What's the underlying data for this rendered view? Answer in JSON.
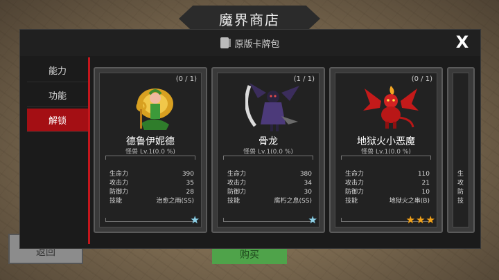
{
  "screen": {
    "title": "魔界商店",
    "back_label": "返回",
    "buy_label": "购买"
  },
  "modal": {
    "header": "原版卡牌包",
    "close_label": "X"
  },
  "sidebar": {
    "items": [
      {
        "label": "能力",
        "active": false
      },
      {
        "label": "功能",
        "active": false
      },
      {
        "label": "解锁",
        "active": true
      }
    ]
  },
  "cards": [
    {
      "count": "(0 / 1)",
      "name": "德鲁伊妮德",
      "level": "怪兽 Lv.1(0.0 %)",
      "stats": [
        {
          "label": "生命力",
          "value": "390"
        },
        {
          "label": "攻击力",
          "value": "35"
        },
        {
          "label": "防御力",
          "value": "28"
        },
        {
          "label": "技能",
          "value": "治愈之雨(SS)"
        }
      ],
      "stars": {
        "count": 1,
        "color": "blue"
      },
      "art_icon": "druid-sprite"
    },
    {
      "count": "(1 / 1)",
      "name": "骨龙",
      "level": "怪兽 Lv.1(0.0 %)",
      "stats": [
        {
          "label": "生命力",
          "value": "380"
        },
        {
          "label": "攻击力",
          "value": "34"
        },
        {
          "label": "防御力",
          "value": "30"
        },
        {
          "label": "技能",
          "value": "腐朽之息(SS)"
        }
      ],
      "stars": {
        "count": 1,
        "color": "blue"
      },
      "art_icon": "bone-dragon-sprite"
    },
    {
      "count": "(0 / 1)",
      "name": "地狱火小恶魔",
      "level": "怪兽 Lv.1(0.0 %)",
      "stats": [
        {
          "label": "生命力",
          "value": "110"
        },
        {
          "label": "攻击力",
          "value": "21"
        },
        {
          "label": "防御力",
          "value": "10"
        },
        {
          "label": "技能",
          "value": "地狱火之串(B)"
        }
      ],
      "stars": {
        "count": 3,
        "color": "gold"
      },
      "art_icon": "hellfire-imp-sprite"
    }
  ],
  "partial_card": {
    "stat_labels": [
      "生",
      "攻",
      "防",
      "技"
    ]
  }
}
